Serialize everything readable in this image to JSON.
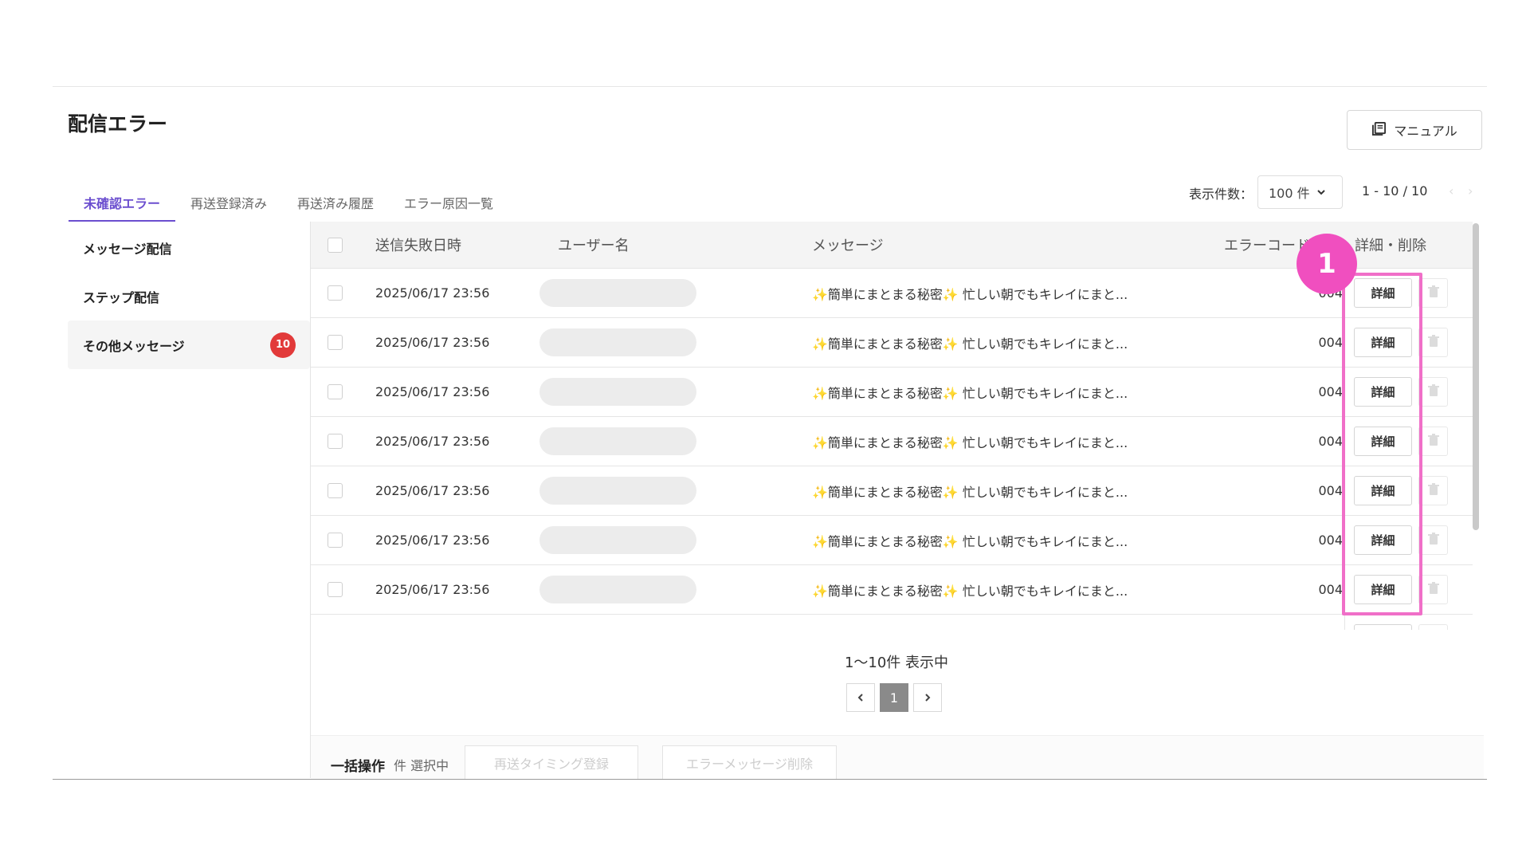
{
  "page": {
    "title": "配信エラー"
  },
  "manual": {
    "label": "マニュアル"
  },
  "tabs": [
    {
      "label": "未確認エラー",
      "active": true
    },
    {
      "label": "再送登録済み"
    },
    {
      "label": "再送済み履歴"
    },
    {
      "label": "エラー原因一覧"
    }
  ],
  "display": {
    "count_label": "表示件数：",
    "count_value": "100 件",
    "range": "1 - 10 / 10"
  },
  "sidebar": {
    "items": [
      {
        "label": "メッセージ配信"
      },
      {
        "label": "ステップ配信"
      },
      {
        "label": "その他メッセージ",
        "badge": "10"
      }
    ]
  },
  "table": {
    "headers": {
      "date": "送信失敗日時",
      "user": "ユーザー名",
      "message": "メッセージ",
      "error_code": "エラーコード",
      "action": "詳細・削除"
    },
    "rows": [
      {
        "date": "2025/06/17 23:56",
        "message": "✨簡単にまとまる秘密✨ 忙しい朝でもキレイにまと...",
        "error_code": "004",
        "detail_label": "詳細"
      },
      {
        "date": "2025/06/17 23:56",
        "message": "✨簡単にまとまる秘密✨ 忙しい朝でもキレイにまと...",
        "error_code": "004",
        "detail_label": "詳細"
      },
      {
        "date": "2025/06/17 23:56",
        "message": "✨簡単にまとまる秘密✨ 忙しい朝でもキレイにまと...",
        "error_code": "004",
        "detail_label": "詳細"
      },
      {
        "date": "2025/06/17 23:56",
        "message": "✨簡単にまとまる秘密✨ 忙しい朝でもキレイにまと...",
        "error_code": "004",
        "detail_label": "詳細"
      },
      {
        "date": "2025/06/17 23:56",
        "message": "✨簡単にまとまる秘密✨ 忙しい朝でもキレイにまと...",
        "error_code": "004",
        "detail_label": "詳細"
      },
      {
        "date": "2025/06/17 23:56",
        "message": "✨簡単にまとまる秘密✨ 忙しい朝でもキレイにまと...",
        "error_code": "004",
        "detail_label": "詳細"
      },
      {
        "date": "2025/06/17 23:56",
        "message": "✨簡単にまとまる秘密✨ 忙しい朝でもキレイにまと...",
        "error_code": "004",
        "detail_label": "詳細"
      }
    ]
  },
  "annotation": {
    "step_number": "1",
    "color": "#f04fbf"
  },
  "pagination": {
    "showing": "1～10件 表示中",
    "current_page": "1"
  },
  "bulk": {
    "label": "一括操作",
    "count_text": "件 選択中",
    "resend_label": "再送タイミング登録",
    "delete_label": "エラーメッセージ削除"
  },
  "colors": {
    "accent": "#6b4ecf",
    "badge": "#e23a3a",
    "highlight": "#f06fc8"
  }
}
